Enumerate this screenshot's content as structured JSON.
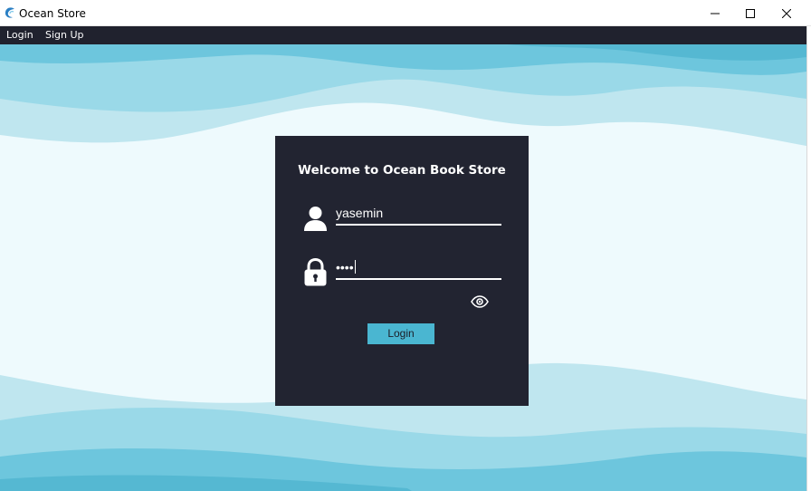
{
  "window": {
    "title": "Ocean Store",
    "icon": "ocean-wave-icon",
    "controls": [
      "minimize-icon",
      "maximize-icon",
      "close-icon"
    ]
  },
  "menu": {
    "items": [
      {
        "label": "Login"
      },
      {
        "label": "Sign Up"
      }
    ]
  },
  "login_card": {
    "heading": "Welcome to Ocean Book Store",
    "username": {
      "icon": "user-icon",
      "value": "yasemin"
    },
    "password": {
      "icon": "lock-icon",
      "masked_value": "••••"
    },
    "show_password_icon": "eye-icon",
    "login_button": "Login"
  },
  "colors": {
    "menubar": "#20222e",
    "card": "#222431",
    "button": "#4ab6d1",
    "wave_light": "#bfe6ef",
    "wave_mid": "#9ad9e8",
    "wave_dark": "#6dc6dd",
    "background": "#eefafd"
  }
}
